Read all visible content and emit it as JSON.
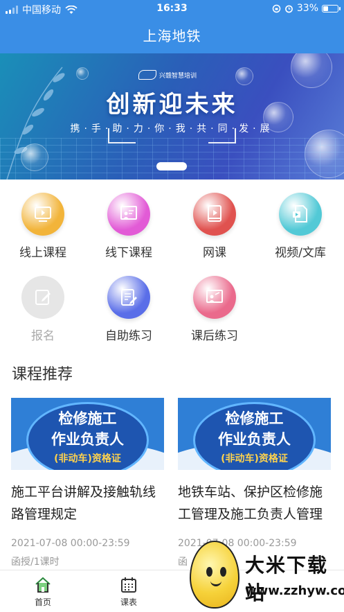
{
  "status_bar": {
    "carrier": "中国移动",
    "time": "16:33",
    "battery": "33%",
    "battery_level": 0.33
  },
  "header": {
    "title": "上海地铁"
  },
  "banner": {
    "brand": "兴赣智慧培训",
    "title": "创新迎未来",
    "subtitle": "携·手·助·力·你·我·共·同·发·展"
  },
  "features": [
    {
      "label": "线上课程",
      "icon": "video-screen-icon",
      "color": "#f2b43a"
    },
    {
      "label": "线下课程",
      "icon": "teacher-board-icon",
      "color": "#e25bd6"
    },
    {
      "label": "网课",
      "icon": "video-book-icon",
      "color": "#e0524f"
    },
    {
      "label": "视频/文库",
      "icon": "video-file-icon",
      "color": "#52c9d6"
    },
    {
      "label": "报名",
      "icon": "edit-icon",
      "color": "#e6e6e6",
      "disabled": true
    },
    {
      "label": "自助练习",
      "icon": "exercise-icon",
      "color": "#5a6ee8"
    },
    {
      "label": "课后练习",
      "icon": "review-board-icon",
      "color": "#ea6a8c"
    }
  ],
  "section": {
    "title": "课程推荐"
  },
  "courses": [
    {
      "badge_line1": "检修施工",
      "badge_line2": "作业负责人",
      "badge_line3": "(非动车)资格证",
      "title": "施工平台讲解及接触轨线路管理规定",
      "time": "2021-07-08 00:00-23:59",
      "meta": "函授/1课时"
    },
    {
      "badge_line1": "检修施工",
      "badge_line2": "作业负责人",
      "badge_line3": "(非动车)资格证",
      "title": "地铁车站、保护区检修施工管理及施工负责人管理",
      "time": "2021-07-08 00:00-23:59",
      "meta": "函"
    }
  ],
  "bottom_nav": [
    {
      "label": "首页",
      "icon": "home-icon",
      "active": true
    },
    {
      "label": "课表",
      "icon": "calendar-icon",
      "active": false
    }
  ],
  "watermark": {
    "text": "大米下载站",
    "url": "www.zzhyw.com"
  }
}
